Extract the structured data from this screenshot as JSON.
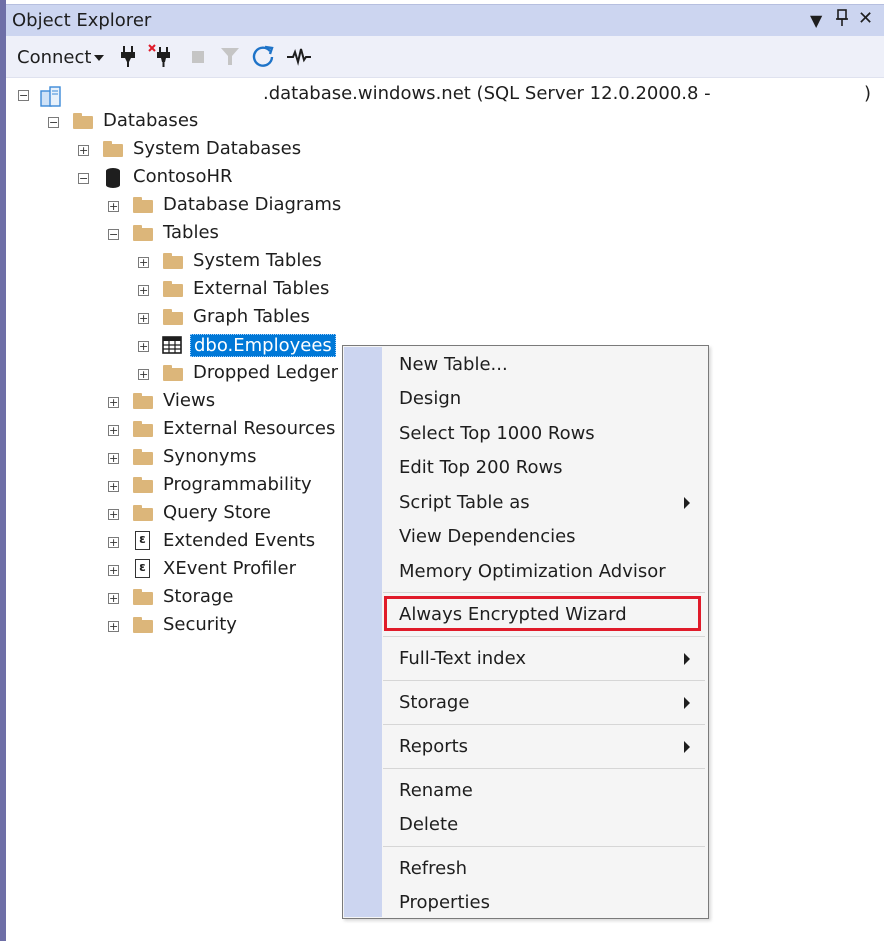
{
  "titlebar": {
    "title": "Object Explorer"
  },
  "toolbar": {
    "connect_label": "Connect",
    "icons": [
      "plug-icon",
      "disconnect-icon",
      "stop-icon",
      "filter-icon",
      "refresh-icon",
      "activity-icon"
    ]
  },
  "tree": {
    "server": ".database.windows.net (SQL Server 12.0.2000.8 -",
    "server_suffix": ")",
    "databases": "Databases",
    "system_databases": "System Databases",
    "db_name": "ContosoHR",
    "database_diagrams": "Database Diagrams",
    "tables": "Tables",
    "system_tables": "System Tables",
    "external_tables": "External Tables",
    "graph_tables": "Graph Tables",
    "selected_table": "dbo.Employees",
    "dropped_ledger": "Dropped Ledger T",
    "views": "Views",
    "external_resources": "External Resources",
    "synonyms": "Synonyms",
    "programmability": "Programmability",
    "query_store": "Query Store",
    "extended_events": "Extended Events",
    "xevent_profiler": "XEvent Profiler",
    "storage": "Storage",
    "security": "Security"
  },
  "context_menu": {
    "new_table": "New Table...",
    "design": "Design",
    "select_top": "Select Top 1000 Rows",
    "edit_top": "Edit Top 200 Rows",
    "script_table_as": "Script Table as",
    "view_dependencies": "View Dependencies",
    "memory_optimization": "Memory Optimization Advisor",
    "always_encrypted": "Always Encrypted Wizard",
    "full_text_index": "Full-Text index",
    "storage": "Storage",
    "reports": "Reports",
    "rename": "Rename",
    "delete": "Delete",
    "refresh": "Refresh",
    "properties": "Properties",
    "highlight_color": "#e01b2a"
  }
}
